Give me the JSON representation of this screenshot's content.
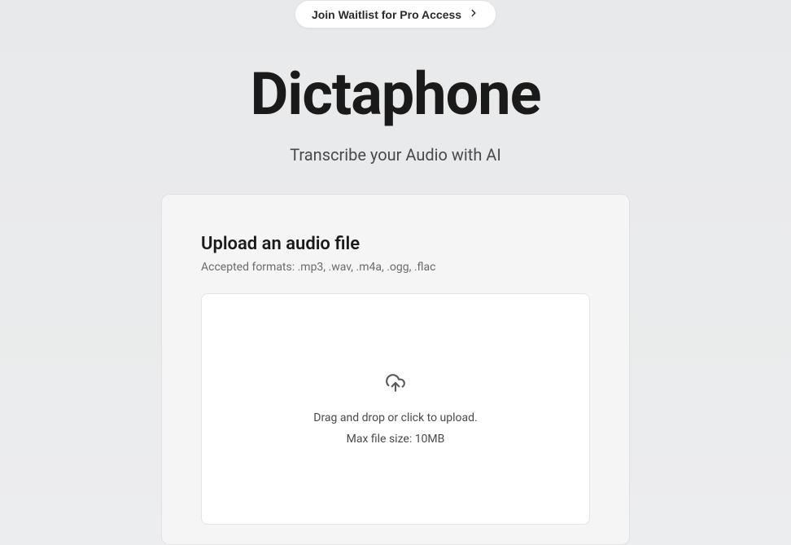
{
  "header": {
    "waitlist_label": "Join Waitlist for Pro Access"
  },
  "hero": {
    "title": "Dictaphone",
    "subtitle": "Transcribe your Audio with AI"
  },
  "upload": {
    "title": "Upload an audio file",
    "accepted_formats": "Accepted formats: .mp3, .wav, .m4a, .ogg, .flac",
    "dropzone_text": "Drag and drop or click to upload.",
    "max_file_size": "Max file size: 10MB"
  }
}
